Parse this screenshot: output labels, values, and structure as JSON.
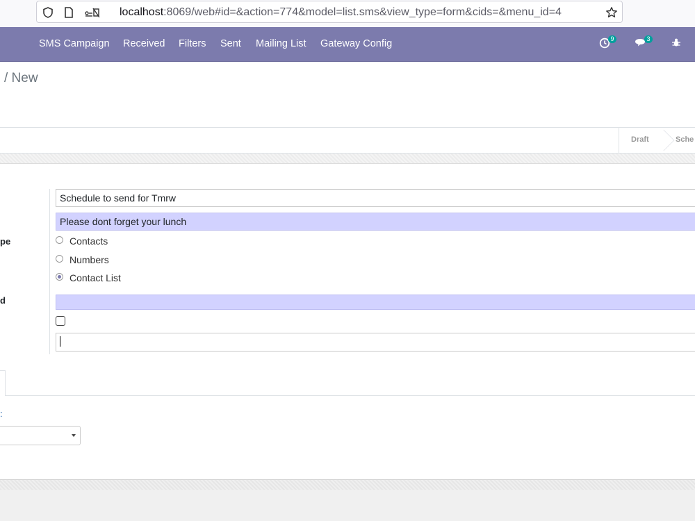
{
  "browser": {
    "url_host": "localhost",
    "url_rest": ":8069/web#id=&action=774&model=list.sms&view_type=form&cids=&menu_id=4",
    "icons": [
      "shield-icon",
      "page-icon",
      "permissions-icon",
      "star-icon"
    ]
  },
  "navbar": {
    "items": [
      {
        "label": "SMS Campaign"
      },
      {
        "label": "Received"
      },
      {
        "label": "Filters"
      },
      {
        "label": "Sent"
      },
      {
        "label": "Mailing List"
      },
      {
        "label": "Gateway Config"
      }
    ],
    "activity_count": "9",
    "messages_count": "3",
    "color": "#7c7bad"
  },
  "breadcrumb": {
    "current": "/ New"
  },
  "statusbar": {
    "stages": [
      "Draft",
      "Sche"
    ]
  },
  "form": {
    "labels": {
      "type_label_fragment": "pe",
      "required_label_fragment": "d"
    },
    "subject": "Schedule to send for Tmrw",
    "message": "Please dont forget your lunch",
    "recipient_options": [
      {
        "label": "Contacts",
        "checked": false
      },
      {
        "label": "Numbers",
        "checked": false
      },
      {
        "label": "Contact List",
        "checked": true
      }
    ],
    "required_field_value": "",
    "checkbox_checked": false,
    "text_input_value": "",
    "link_fragment": ":",
    "select_value": ""
  }
}
